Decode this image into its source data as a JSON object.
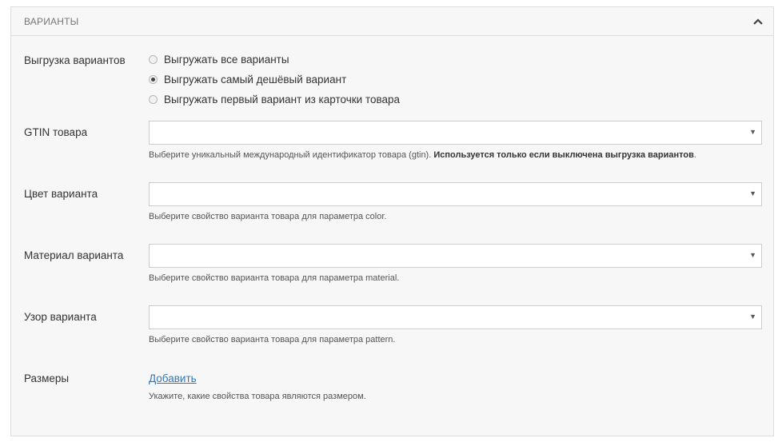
{
  "panel": {
    "title": "ВАРИАНТЫ",
    "collapse_icon": "chevron-up-icon"
  },
  "variants_export": {
    "label": "Выгрузка вариантов",
    "options": [
      {
        "label": "Выгружать все варианты",
        "checked": false
      },
      {
        "label": "Выгружать самый дешёвый вариант",
        "checked": true
      },
      {
        "label": "Выгружать первый вариант из карточки товара",
        "checked": false
      }
    ]
  },
  "gtin": {
    "label": "GTIN товара",
    "value": "",
    "help": "Выберите уникальный международный идентификатор товара (gtin).",
    "help_bold": "Используется только если выключена выгрузка вариантов",
    "help_end": "."
  },
  "color": {
    "label": "Цвет варианта",
    "value": "",
    "help": "Выберите свойство варианта товара для параметра color."
  },
  "material": {
    "label": "Материал варианта",
    "value": "",
    "help": "Выберите свойство варианта товара для параметра material."
  },
  "pattern": {
    "label": "Узор варианта",
    "value": "",
    "help": "Выберите свойство варианта товара для параметра pattern."
  },
  "sizes": {
    "label": "Размеры",
    "add_link": "Добавить",
    "help": "Укажите, какие свойства товара являются размером."
  },
  "colors": {
    "panel_bg": "#f7f7f7",
    "border": "#dddddd",
    "link": "#2f77b8"
  }
}
